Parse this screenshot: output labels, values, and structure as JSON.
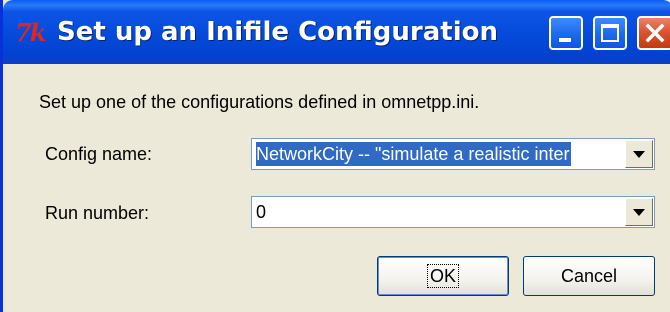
{
  "window": {
    "title": "Set up an Inifile Configuration",
    "app_icon": "tk-logo-icon",
    "logo_text": "Tk"
  },
  "titlebar_buttons": {
    "minimize_icon": "minimize-icon",
    "maximize_icon": "maximize-icon",
    "close_icon": "close-icon"
  },
  "dialog": {
    "message": "Set up one of the configurations defined in omnetpp.ini.",
    "config": {
      "label": "Config name:",
      "value": "NetworkCity -- \"simulate a realistic inter",
      "dropdown_icon": "chevron-down-icon"
    },
    "run": {
      "label": "Run number:",
      "value": "0",
      "dropdown_icon": "chevron-down-icon"
    }
  },
  "buttons": {
    "ok_label": "OK",
    "cancel_label": "Cancel"
  },
  "colors": {
    "titlebar": "#0449d8",
    "close_button": "#d8522c",
    "selection": "#316ac5",
    "dialog_bg": "#ece9d8"
  }
}
